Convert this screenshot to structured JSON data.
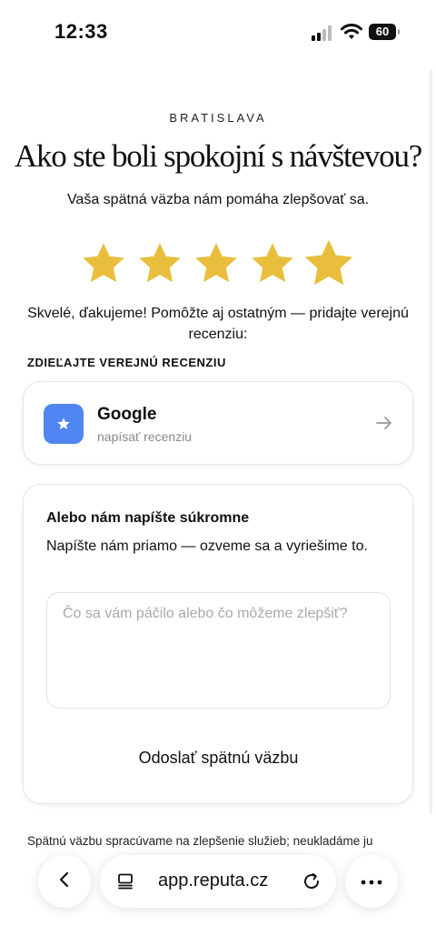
{
  "status_bar": {
    "time": "12:33",
    "battery": "60"
  },
  "header": {
    "city": "BRATISLAVA",
    "title": "Ako ste boli spokojní s návštevou?",
    "subtitle": "Vaša spätná väzba nám pomáha zlepšovať sa."
  },
  "rating": {
    "value": 5,
    "max": 5,
    "star_color": "#E8BE3C"
  },
  "thanks_text": "Skvelé, ďakujeme! Pomôžte aj ostatným — pridajte verejnú recenziu:",
  "public_review": {
    "section_label": "ZDIEĽAJTE VEREJNÚ RECENZIU",
    "google": {
      "title": "Google",
      "subtitle": "napísať recenziu",
      "icon": "star-icon",
      "icon_bg": "#4F86F2"
    }
  },
  "private_feedback": {
    "title": "Alebo nám napíšte súkromne",
    "description": "Napíšte nám priamo — ozveme sa a vyriešime to.",
    "placeholder": "Čo sa vám páčilo alebo čo môžeme zlepšiť?",
    "submit_label": "Odoslať spätnú väzbu"
  },
  "footnote": "Spätnú väzbu spracúvame na zlepšenie služieb; neukladáme ju",
  "browser": {
    "url": "app.reputa.cz"
  }
}
